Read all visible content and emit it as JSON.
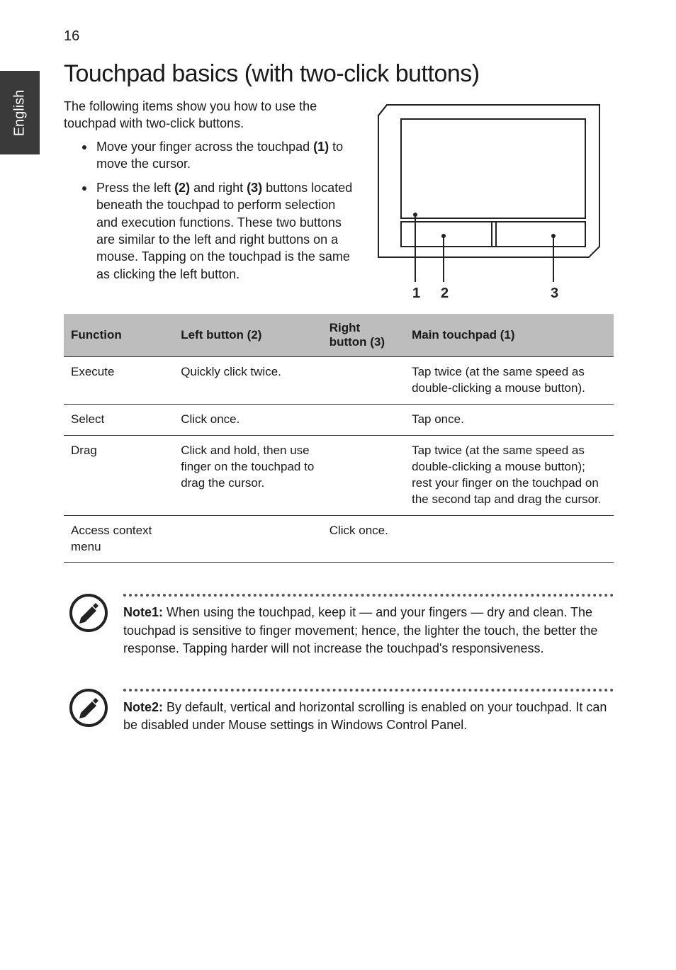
{
  "page_number": "16",
  "side_tab": "English",
  "heading": "Touchpad basics (with two-click buttons)",
  "intro": "The following items show you how to use the touchpad with two-click buttons.",
  "bullets": [
    {
      "text_before": "Move your finger across the touchpad ",
      "bold": "(1)",
      "text_after": " to move the cursor."
    },
    {
      "text_before": "Press the left ",
      "bold": "(2)",
      "mid": " and right ",
      "bold2": "(3)",
      "text_after": " buttons located beneath the touchpad to perform selection and execution functions. These two buttons are similar to the left and right buttons on a mouse. Tapping on the touchpad is the same as clicking the left button."
    }
  ],
  "diagram_labels": {
    "one": "1",
    "two": "2",
    "three": "3"
  },
  "table": {
    "headers": {
      "function": "Function",
      "left": "Left button (2)",
      "right": "Right button (3)",
      "main": "Main touchpad (1)"
    },
    "rows": [
      {
        "function": "Execute",
        "left": "Quickly click twice.",
        "right": "",
        "main": "Tap twice (at the same speed as double-clicking a mouse button)."
      },
      {
        "function": "Select",
        "left": "Click once.",
        "right": "",
        "main": "Tap once."
      },
      {
        "function": "Drag",
        "left": "Click and hold, then use finger on the touchpad to drag the cursor.",
        "right": "",
        "main": "Tap twice (at the same speed as double-clicking a mouse button); rest your finger on the touchpad on the second tap and drag the cursor."
      },
      {
        "function": "Access context menu",
        "left": "",
        "right": "Click once.",
        "main": ""
      }
    ]
  },
  "notes": [
    {
      "label": "Note1:",
      "text": " When using the touchpad, keep it — and your fingers — dry and clean. The touchpad is sensitive to finger movement; hence, the lighter the touch, the better the response. Tapping harder will not increase the touchpad's responsiveness."
    },
    {
      "label": "Note2:",
      "text": " By default, vertical and horizontal scrolling is enabled on your touchpad. It can be disabled under Mouse settings in Windows Control Panel."
    }
  ],
  "chart_data": {
    "type": "table",
    "title": "Touchpad function comparison (two-click buttons)",
    "columns": [
      "Function",
      "Left button (2)",
      "Right button (3)",
      "Main touchpad (1)"
    ],
    "rows": [
      [
        "Execute",
        "Quickly click twice.",
        "",
        "Tap twice (at the same speed as double-clicking a mouse button)."
      ],
      [
        "Select",
        "Click once.",
        "",
        "Tap once."
      ],
      [
        "Drag",
        "Click and hold, then use finger on the touchpad to drag the cursor.",
        "",
        "Tap twice (at the same speed as double-clicking a mouse button); rest your finger on the touchpad on the second tap and drag the cursor."
      ],
      [
        "Access context menu",
        "",
        "Click once.",
        ""
      ]
    ]
  }
}
